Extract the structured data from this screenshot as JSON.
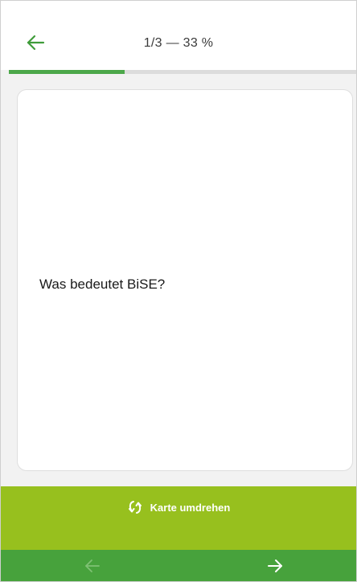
{
  "header": {
    "back_icon": "arrow-left-icon",
    "progress_label": "1/3 — 33 %",
    "progress_fraction": 0.333,
    "accent_color": "#4ca84a"
  },
  "card": {
    "question": "Was bedeutet BiSE?"
  },
  "flip": {
    "icon": "flip-rotate-icon",
    "label": "Karte umdrehen",
    "color": "#97c01e"
  },
  "nav": {
    "prev_icon": "arrow-left-icon",
    "prev_enabled": false,
    "next_icon": "arrow-right-icon",
    "next_enabled": true,
    "color": "#47a23c"
  }
}
